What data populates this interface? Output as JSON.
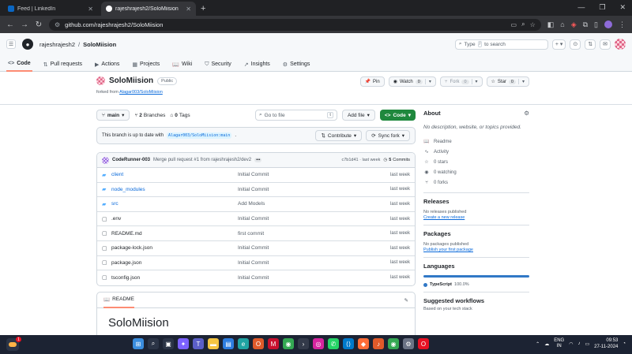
{
  "browser": {
    "tabs": [
      {
        "title": "Feed | LinkedIn",
        "favicon_color": "#0a66c2",
        "active": false
      },
      {
        "title": "rajeshrajesh2/SoloMiision",
        "favicon_color": "#ffffff",
        "active": true
      }
    ],
    "new_tab_label": "+",
    "url": "github.com/rajeshrajesh2/SoloMiision"
  },
  "github": {
    "owner": "rajeshrajesh2",
    "separator": "/",
    "repo": "SoloMiision",
    "search_placeholder": "Type",
    "search_key": "/",
    "search_suffix": "to search",
    "nav_tabs": [
      {
        "label": "Code",
        "icon": "<>",
        "selected": true
      },
      {
        "label": "Pull requests",
        "icon": "⇅",
        "selected": false
      },
      {
        "label": "Actions",
        "icon": "▶",
        "selected": false
      },
      {
        "label": "Projects",
        "icon": "▦",
        "selected": false
      },
      {
        "label": "Wiki",
        "icon": "📖",
        "selected": false
      },
      {
        "label": "Security",
        "icon": "⛉",
        "selected": false
      },
      {
        "label": "Insights",
        "icon": "↗",
        "selected": false
      },
      {
        "label": "Settings",
        "icon": "⚙",
        "selected": false
      }
    ]
  },
  "repo": {
    "name": "SoloMiision",
    "visibility": "Public",
    "forked_prefix": "forked from",
    "forked_from": "Alagar003/SoloMiision",
    "pin_label": "Pin",
    "watch_label": "Watch",
    "watch_count": "0",
    "fork_label": "Fork",
    "fork_count": "0",
    "star_label": "Star",
    "star_count": "0"
  },
  "toolbar": {
    "branch": "main",
    "branches_count": "2",
    "branches_label": "Branches",
    "tags_count": "0",
    "tags_label": "Tags",
    "goto_placeholder": "Go to file",
    "goto_key": "t",
    "add_file_label": "Add file",
    "code_label": "Code"
  },
  "sync": {
    "message": "This branch is up to date with",
    "ref": "Alagar003/SoloMiision:main",
    "suffix": ".",
    "contribute_label": "Contribute",
    "sync_label": "Sync fork"
  },
  "commit": {
    "author": "CodeRunner-003",
    "message": "Merge pull request #1 from rajeshrajesh2/dev2",
    "hash": "c7b1d41",
    "separator": "·",
    "time": "last week",
    "commits_count": "5",
    "commits_label": "Commits"
  },
  "files": [
    {
      "name": "client",
      "type": "dir",
      "message": "Initial Commit",
      "date": "last week"
    },
    {
      "name": "node_modules",
      "type": "dir",
      "message": "Initial Commit",
      "date": "last week"
    },
    {
      "name": "src",
      "type": "dir",
      "message": "Add Models",
      "date": "last week"
    },
    {
      "name": ".env",
      "type": "file",
      "message": "Initial Commit",
      "date": "last week"
    },
    {
      "name": "README.md",
      "type": "file",
      "message": "first commit",
      "date": "last week"
    },
    {
      "name": "package-lock.json",
      "type": "file",
      "message": "Initial Commit",
      "date": "last week"
    },
    {
      "name": "package.json",
      "type": "file",
      "message": "Initial Commit",
      "date": "last week"
    },
    {
      "name": "tsconfig.json",
      "type": "file",
      "message": "Initial Commit",
      "date": "last week"
    }
  ],
  "readme": {
    "tab_label": "README",
    "title": "SoloMiision"
  },
  "sidebar": {
    "about_title": "About",
    "description": "No description, website, or topics provided.",
    "links": [
      {
        "icon": "📖",
        "label": "Readme"
      },
      {
        "icon": "∿",
        "label": "Activity"
      },
      {
        "icon": "☆",
        "label": "0 stars"
      },
      {
        "icon": "◉",
        "label": "0 watching"
      },
      {
        "icon": "⑂",
        "label": "0 forks"
      }
    ],
    "releases_title": "Releases",
    "releases_none": "No releases published",
    "releases_link": "Create a new release",
    "packages_title": "Packages",
    "packages_none": "No packages published",
    "packages_link": "Publish your first package",
    "languages_title": "Languages",
    "language_name": "TypeScript",
    "language_pct": "100.0%",
    "language_color": "#3178c6",
    "workflows_title": "Suggested workflows",
    "workflows_sub": "Based on your tech stack"
  },
  "taskbar": {
    "notification_count": "1",
    "lang_top": "ENG",
    "lang_bottom": "IN",
    "time": "09:53",
    "date": "27-11-2024",
    "apps": [
      {
        "icon": "windows-icon",
        "glyph": "⊞",
        "color": "#3a8dde"
      },
      {
        "icon": "search-icon",
        "glyph": "⌕",
        "color": "#2b3446"
      },
      {
        "icon": "task-view-icon",
        "glyph": "▣",
        "color": "#2b3446"
      },
      {
        "icon": "copilot-icon",
        "glyph": "✦",
        "color": "#7b61ff"
      },
      {
        "icon": "teams-icon",
        "glyph": "T",
        "color": "#5b5fc7"
      },
      {
        "icon": "file-explorer-icon",
        "glyph": "▬",
        "color": "#f5c542"
      },
      {
        "icon": "store-icon",
        "glyph": "▤",
        "color": "#2d7de0"
      },
      {
        "icon": "edge-icon",
        "glyph": "e",
        "color": "#1fa3a3"
      },
      {
        "icon": "office-icon",
        "glyph": "O",
        "color": "#e05a2a"
      },
      {
        "icon": "mcafee-icon",
        "glyph": "M",
        "color": "#c8102e"
      },
      {
        "icon": "chrome-icon",
        "glyph": "◉",
        "color": "#34a853"
      },
      {
        "icon": "terminal-icon",
        "glyph": "›",
        "color": "#333a4a"
      },
      {
        "icon": "instagram-icon",
        "glyph": "◎",
        "color": "#d6249f"
      },
      {
        "icon": "whatsapp-icon",
        "glyph": "✆",
        "color": "#25d366"
      },
      {
        "icon": "vscode-icon",
        "glyph": "⟨⟩",
        "color": "#007acc"
      },
      {
        "icon": "postman-icon",
        "glyph": "◆",
        "color": "#ff6c37"
      },
      {
        "icon": "mic-icon",
        "glyph": "♪",
        "color": "#e05a2a"
      },
      {
        "icon": "chrome-alt-icon",
        "glyph": "◉",
        "color": "#34a853"
      },
      {
        "icon": "settings-icon",
        "glyph": "⚙",
        "color": "#6b7385"
      },
      {
        "icon": "opera-icon",
        "glyph": "O",
        "color": "#e81123"
      }
    ]
  }
}
